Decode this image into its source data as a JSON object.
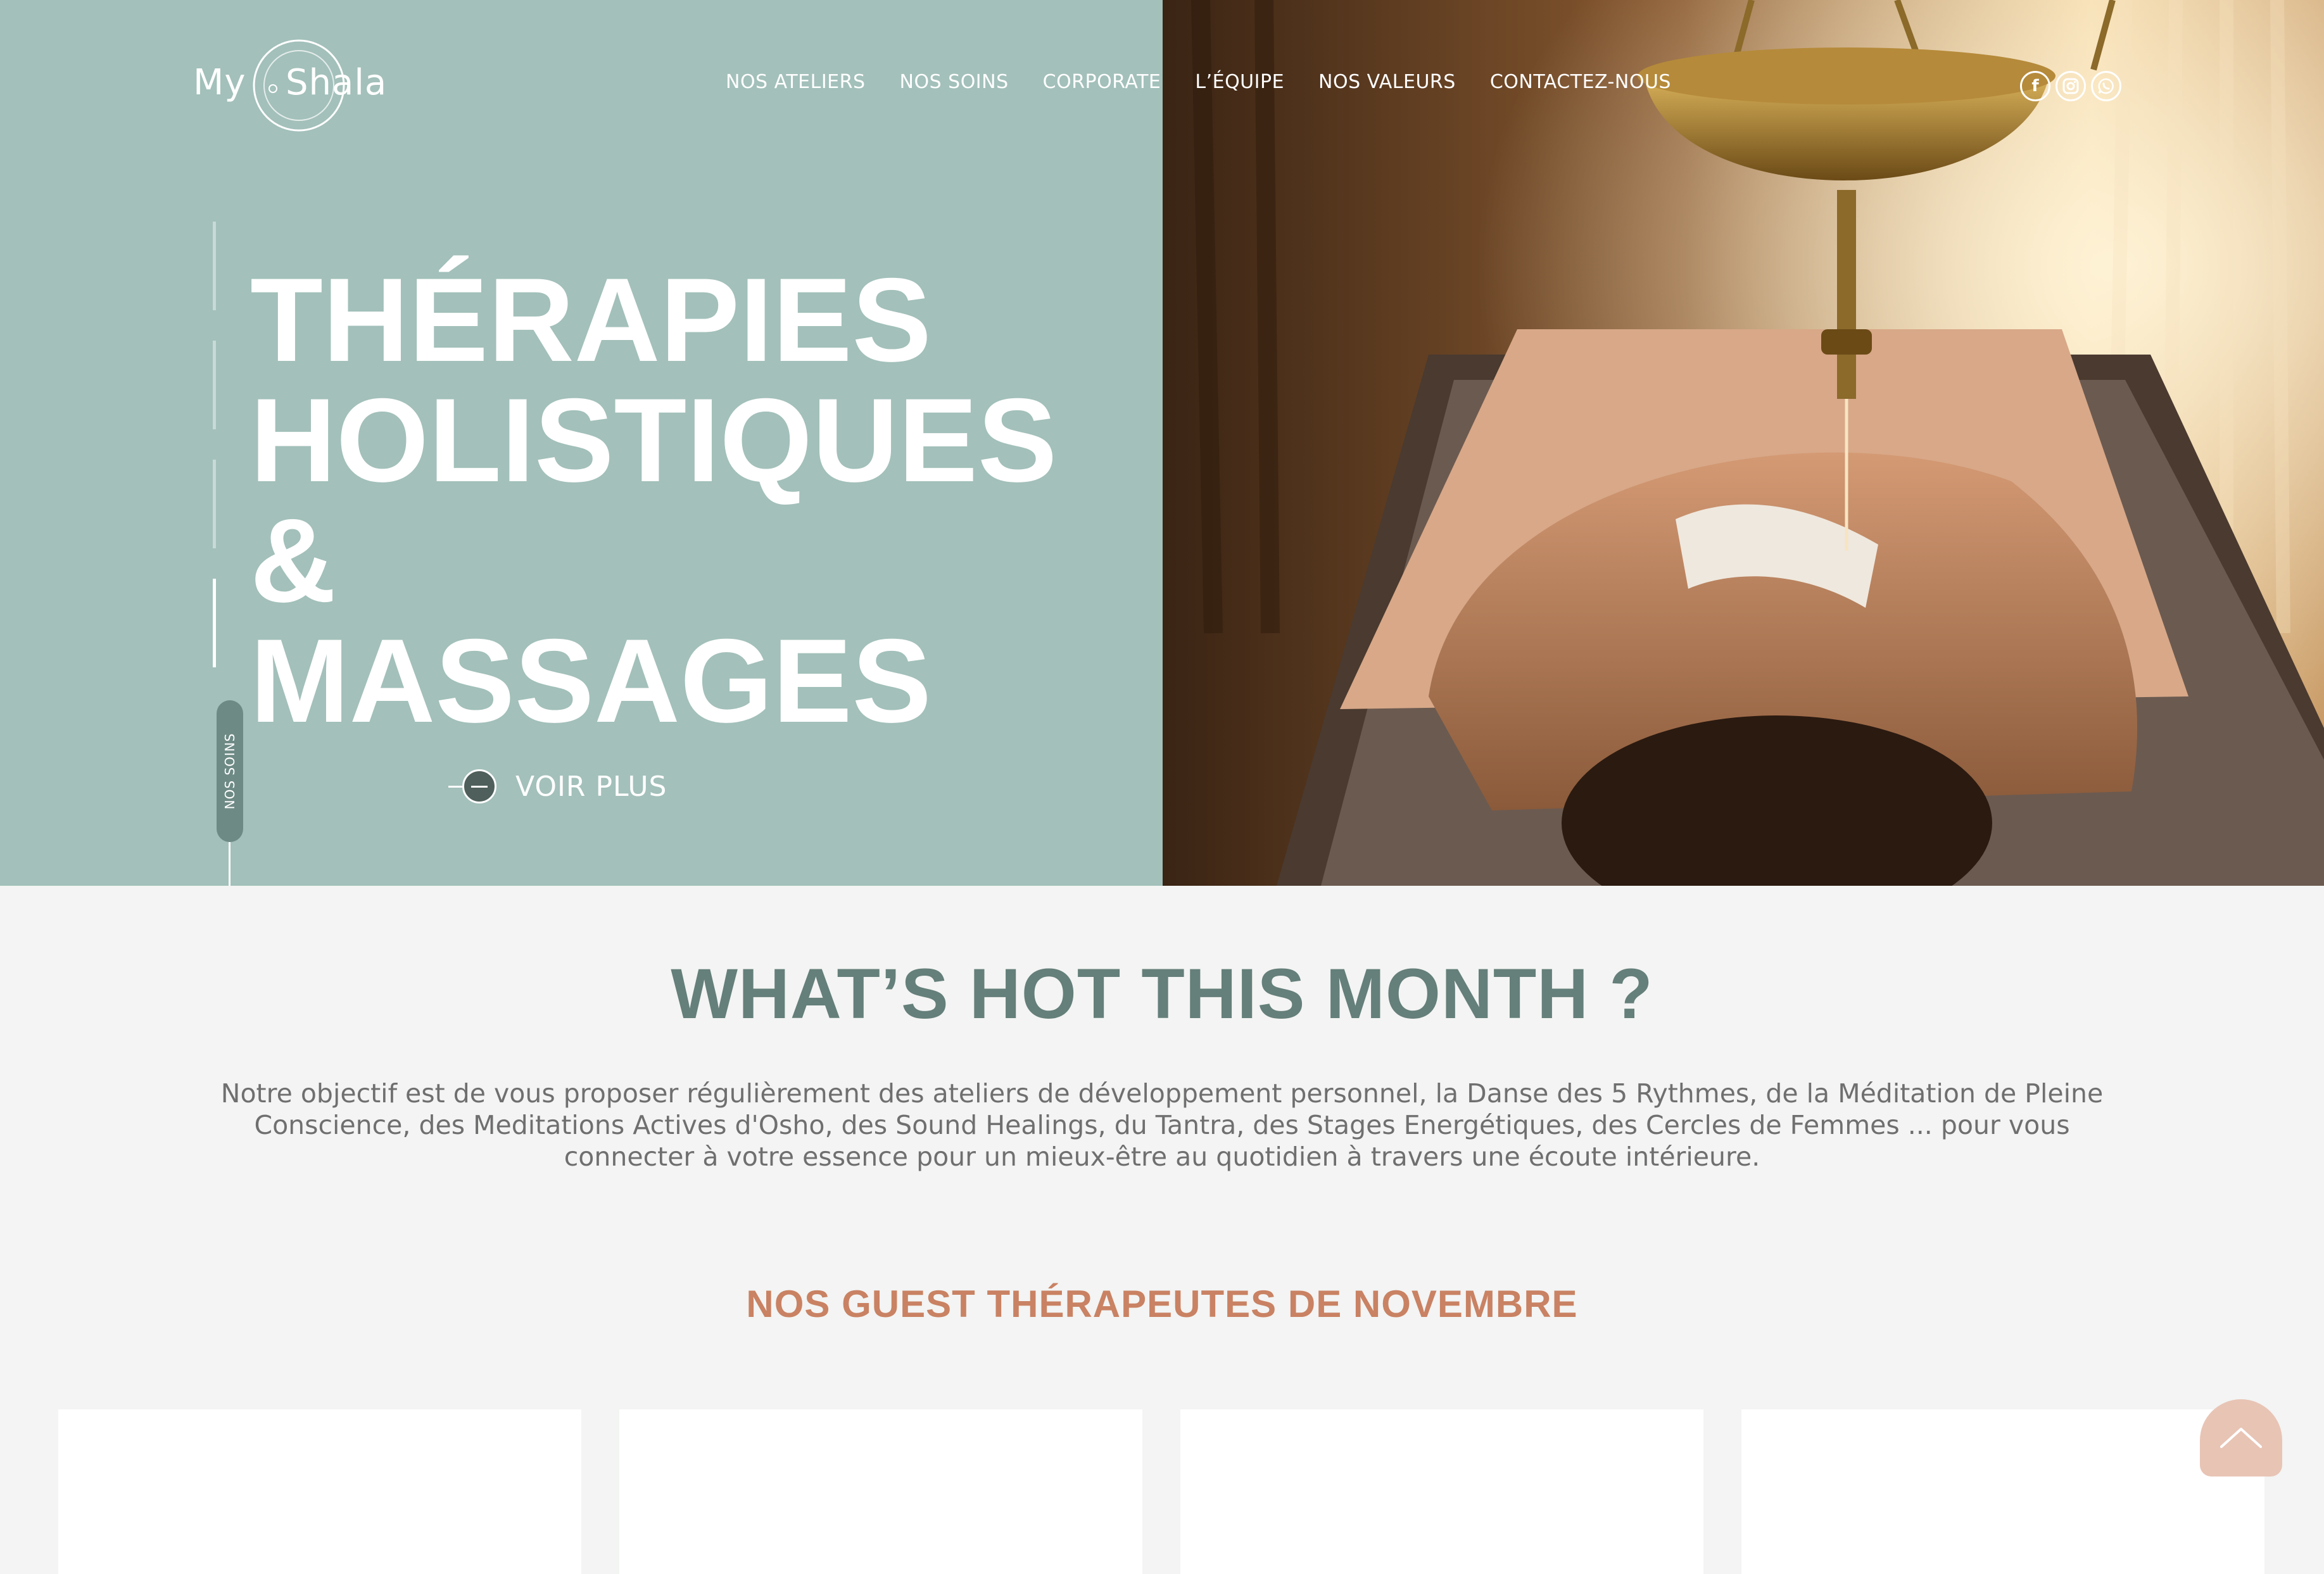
{
  "logo": {
    "text_my": "My",
    "text_shala": "Shala"
  },
  "nav": {
    "items": [
      "NOS ATELIERS",
      "NOS SOINS",
      "CORPORATE",
      "L’ÉQUIPE",
      "NOS VALEURS",
      "CONTACTEZ-NOUS"
    ]
  },
  "socials": {
    "icons": [
      "facebook-icon",
      "instagram-icon",
      "whatsapp-icon"
    ],
    "facebook_glyph": "f"
  },
  "hero": {
    "title": "THÉRAPIES\nHOLISTIQUES\n&\nMASSAGES",
    "cta_label": "VOIR PLUS",
    "side_tab_label": "NOS SOINS",
    "background_color": "#a3c0ba",
    "slide_count": 4,
    "active_slide": 4
  },
  "hot": {
    "title": "WHAT’S HOT THIS MONTH ?",
    "intro": "Notre objectif est de vous proposer régulièrement des ateliers de développement personnel, la Danse des 5 Rythmes, de la Méditation de Pleine Conscience, des Meditations Actives d'Osho, des Sound Healings, du Tantra, des Stages Energétiques, des Cercles de Femmes ... pour vous connecter à votre essence pour un mieux-être au quotidien à travers une écoute intérieure."
  },
  "guests": {
    "title": "NOS GUEST THÉRAPEUTES DE NOVEMBRE",
    "card_count": 4
  },
  "colors": {
    "hero_teal": "#a3c0ba",
    "title_teal": "#657f7a",
    "accent_terracotta": "#c98263",
    "scroll_top": "#e8c4b5"
  }
}
